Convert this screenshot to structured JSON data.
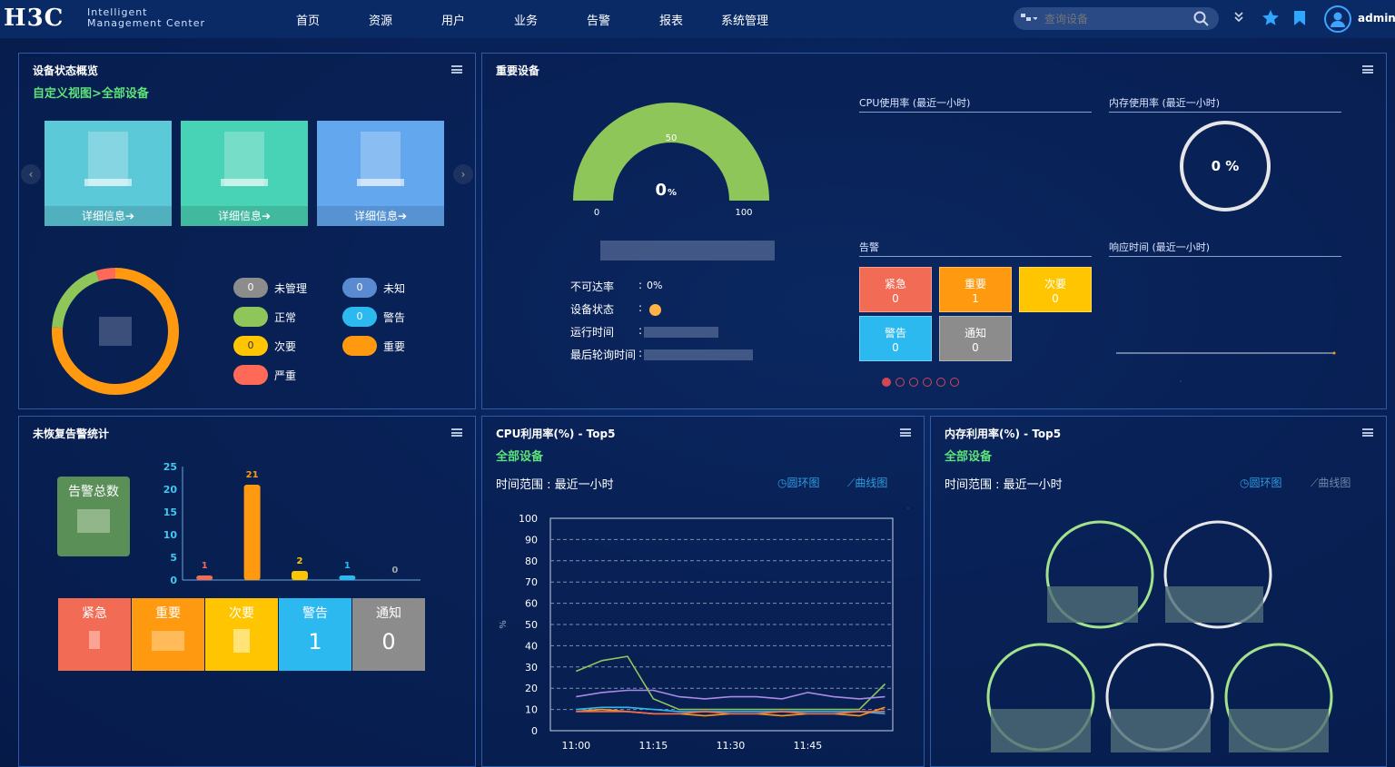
{
  "header": {
    "logo": "H3C",
    "product_line1": "Intelligent",
    "product_line2": "Management Center",
    "nav": [
      "首页",
      "资源",
      "用户",
      "业务",
      "告警",
      "报表",
      "系统管理"
    ],
    "search_placeholder": "查询设备",
    "user": "admin",
    "icons": [
      "search-type-icon",
      "search-icon",
      "chevron-double-down-icon",
      "star-icon",
      "bookmark-icon",
      "user-icon"
    ]
  },
  "device_overview": {
    "title": "设备状态概览",
    "view_path": "自定义视图>全部设备",
    "cards": [
      {
        "detail": "详细信息➔",
        "color": "#5cc9d9"
      },
      {
        "detail": "详细信息➔",
        "color": "#49d3b6"
      },
      {
        "detail": "详细信息➔",
        "color": "#63a8ef"
      }
    ],
    "legend": [
      {
        "label": "未管理",
        "value": "0",
        "color": "#8c8c8c"
      },
      {
        "label": "未知",
        "value": "0",
        "color": "#5a8ad0"
      },
      {
        "label": "正常",
        "value": "",
        "color": "#8fc65a"
      },
      {
        "label": "警告",
        "value": "0",
        "color": "#2cb9ef"
      },
      {
        "label": "次要",
        "value": "0",
        "color": "#ffc500"
      },
      {
        "label": "重要",
        "value": "",
        "color": "#ff9a10"
      },
      {
        "label": "严重",
        "value": "",
        "color": "#ff6a58"
      }
    ],
    "donut": [
      {
        "status": "重要",
        "share": 0.76,
        "color": "#ff9a10"
      },
      {
        "status": "正常",
        "share": 0.19,
        "color": "#8fc65a"
      },
      {
        "status": "严重",
        "share": 0.05,
        "color": "#ff6a58"
      }
    ]
  },
  "important_devices": {
    "title": "重要设备",
    "gauge": {
      "value": "0",
      "unit": "%",
      "min": "0",
      "mid": "50",
      "max": "100",
      "color": "#8fc65a"
    },
    "fields": [
      {
        "label": "不可达率",
        "sep": ":",
        "value": "0%"
      },
      {
        "label": "设备状态",
        "sep": ":",
        "value": ""
      },
      {
        "label": "运行时间",
        "sep": ":",
        "value": ""
      },
      {
        "label": "最后轮询时间",
        "sep": ":",
        "value": ""
      }
    ],
    "cpu_title": "CPU使用率 (最近一小时)",
    "mem_title": "内存使用率 (最近一小时)",
    "mem_value": "0 %",
    "alarm_title": "告警",
    "resp_title": "响应时间 (最近一小时)",
    "alarms": [
      {
        "label": "紧急",
        "value": "0",
        "color": "#f26b55"
      },
      {
        "label": "重要",
        "value": "1",
        "color": "#ff9a10"
      },
      {
        "label": "次要",
        "value": "0",
        "color": "#ffc500"
      },
      {
        "label": "警告",
        "value": "0",
        "color": "#2cb9ef"
      },
      {
        "label": "通知",
        "value": "0",
        "color": "#8c8c8c"
      }
    ],
    "pager_count": 6
  },
  "unrecovered_alarms": {
    "title": "未恢复告警统计",
    "total_label": "告警总数",
    "tiles": [
      {
        "label": "紧急",
        "value": "",
        "color": "#f26b55"
      },
      {
        "label": "重要",
        "value": "",
        "color": "#ff9a10"
      },
      {
        "label": "次要",
        "value": "",
        "color": "#ffc500"
      },
      {
        "label": "警告",
        "value": "1",
        "color": "#2cb9ef"
      },
      {
        "label": "通知",
        "value": "0",
        "color": "#8c8c8c"
      }
    ]
  },
  "cpu_top5": {
    "title": "CPU利用率(%) - Top5",
    "scope": "全部设备",
    "range": "时间范围 : 最近一小时",
    "ring_label": "圆环图",
    "line_label": "曲线图"
  },
  "mem_top5": {
    "title": "内存利用率(%) - Top5",
    "scope": "全部设备",
    "range": "时间范围 : 最近一小时",
    "ring_label": "圆环图",
    "line_label": "曲线图"
  },
  "chart_data": [
    {
      "type": "bar",
      "categories": [
        "紧急",
        "重要",
        "次要",
        "警告",
        "通知"
      ],
      "values": [
        1,
        21,
        2,
        1,
        0
      ],
      "colors": [
        "#f26b55",
        "#ff9a10",
        "#ffc500",
        "#2cb9ef",
        "#8c8c8c"
      ],
      "yticks": [
        0,
        5,
        10,
        15,
        20,
        25
      ],
      "ylim": [
        0,
        25
      ]
    },
    {
      "type": "line",
      "ylabel": "%",
      "ylim": [
        0,
        100
      ],
      "yticks": [
        0,
        10,
        20,
        30,
        40,
        50,
        60,
        70,
        80,
        90,
        100
      ],
      "xticks": [
        "11:00",
        "11:15",
        "11:30",
        "11:45"
      ],
      "x": [
        0,
        5,
        10,
        15,
        20,
        25,
        30,
        35,
        40,
        45,
        50,
        55,
        60
      ],
      "series": [
        {
          "values": [
            28,
            33,
            35,
            15,
            10,
            10,
            10,
            10,
            10,
            10,
            10,
            10,
            22
          ],
          "color": "#8fc65a"
        },
        {
          "values": [
            16,
            18,
            19,
            19,
            16,
            15,
            16,
            16,
            15,
            18,
            16,
            15,
            16
          ],
          "color": "#a98be6"
        },
        {
          "values": [
            10,
            11,
            11,
            10,
            9,
            9,
            9,
            9,
            9,
            9,
            9,
            9,
            8
          ],
          "color": "#2cb9ef"
        },
        {
          "values": [
            9,
            10,
            9,
            8,
            8,
            7,
            8,
            8,
            7,
            8,
            8,
            7,
            11
          ],
          "color": "#ff9a10"
        },
        {
          "values": [
            9,
            9,
            9,
            8,
            8,
            9,
            8,
            8,
            9,
            8,
            8,
            9,
            9
          ],
          "color": "#f26b55"
        }
      ]
    }
  ]
}
